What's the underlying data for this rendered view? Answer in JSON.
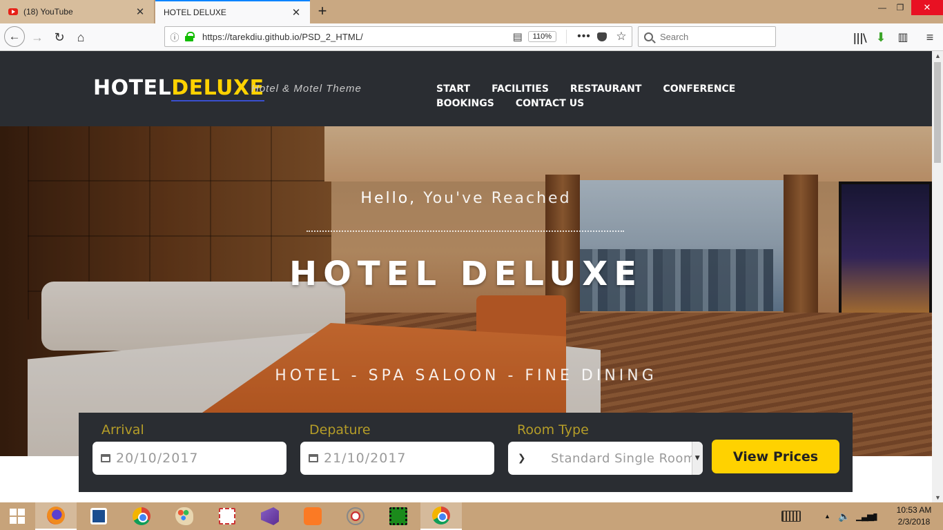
{
  "browser": {
    "tabs": [
      {
        "title": "(18) YouTube",
        "active": false
      },
      {
        "title": "HOTEL DELUXE",
        "active": true
      }
    ],
    "url": "https://tarekdiu.github.io/PSD_2_HTML/",
    "zoom": "110%",
    "search_placeholder": "Search",
    "icons": {
      "back": "←",
      "forward": "→",
      "reload": "↻",
      "home": "⌂",
      "info": "ⓘ",
      "reader": "▤",
      "more": "•••",
      "star": "☆",
      "library": "|||\\",
      "download": "⬇",
      "sidebar": "▥",
      "menu": "≡",
      "tab_close": "✕",
      "new_tab": "+",
      "minimize": "—",
      "maximize": "❐",
      "close": "✕"
    }
  },
  "site": {
    "logo_white": "HOTEL",
    "logo_yellow": "DELUXE",
    "tagline": "Hotel & Motel Theme",
    "nav": [
      "START",
      "FACILITIES",
      "RESTAURANT",
      "CONFERENCE",
      "BOOKINGS",
      "CONTACT US"
    ],
    "hero": {
      "hello_strong": "Hello,",
      "hello_rest": "You've Reached",
      "title": "HOTEL DELUXE",
      "subtitle": "HOTEL - SPA SALOON - FINE DINING"
    },
    "booking": {
      "arrival_label": "Arrival",
      "arrival_value": "20/10/2017",
      "departure_label": "Depature",
      "departure_value": "21/10/2017",
      "room_label": "Room Type",
      "room_value": "Standard Single Room",
      "button": "View Prices"
    }
  },
  "taskbar": {
    "apps": [
      "firefox-icon",
      "vscode-icon",
      "chrome-icon",
      "paint-icon",
      "snipping-tool-icon",
      "visual-studio-icon",
      "xampp-icon",
      "tool-icon",
      "emulator-icon",
      "chrome-icon"
    ],
    "active_app": "firefox-icon",
    "tray_icons": {
      "caret": "▲",
      "volume": "🔈",
      "network": "▁▃▅",
      "battery": "▮"
    },
    "time": "10:53 AM",
    "date": "2/3/2018"
  },
  "colors": {
    "accent_yellow": "#ffd200",
    "header_dark": "#2a2d32",
    "label_gold": "#b59d28",
    "tab_accent": "#0a84ff"
  }
}
